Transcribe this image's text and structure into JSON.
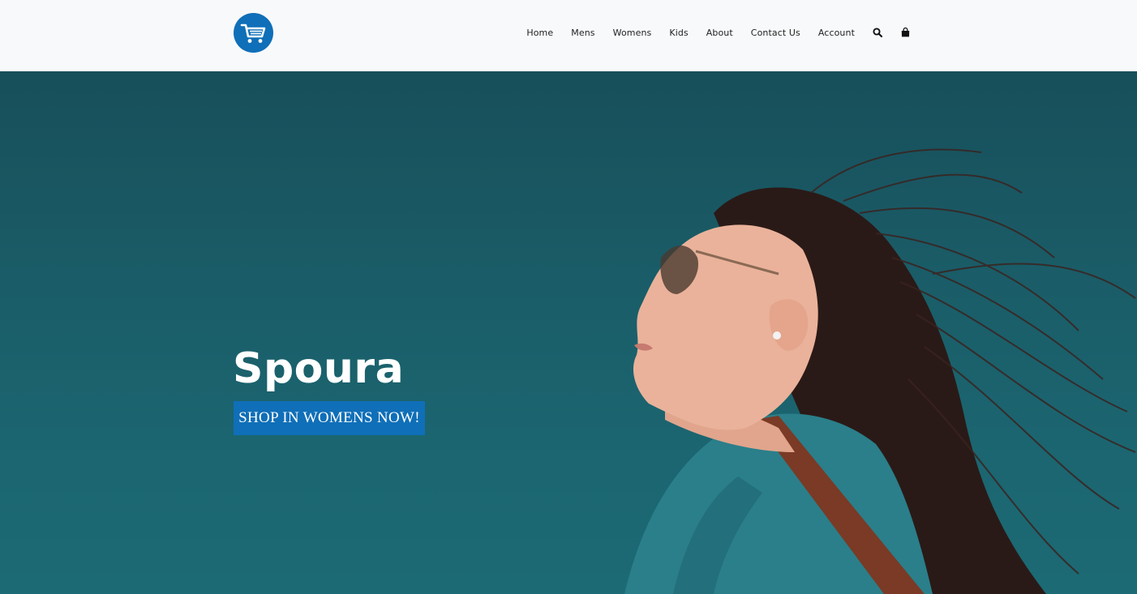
{
  "brand": {
    "logo_icon": "shopping-cart-icon",
    "logo_color": "#0f6fb8"
  },
  "nav": {
    "items": [
      {
        "label": "Home"
      },
      {
        "label": "Mens"
      },
      {
        "label": "Womens"
      },
      {
        "label": "Kids"
      },
      {
        "label": "About"
      },
      {
        "label": "Contact Us"
      },
      {
        "label": "Account"
      }
    ],
    "search_icon": "search-icon",
    "bag_icon": "shopping-bag-icon"
  },
  "hero": {
    "title": "Spoura",
    "cta_label": "SHOP IN WOMENS NOW!",
    "background_color": "#1a5b66",
    "cta_color": "#0f6fb8"
  }
}
